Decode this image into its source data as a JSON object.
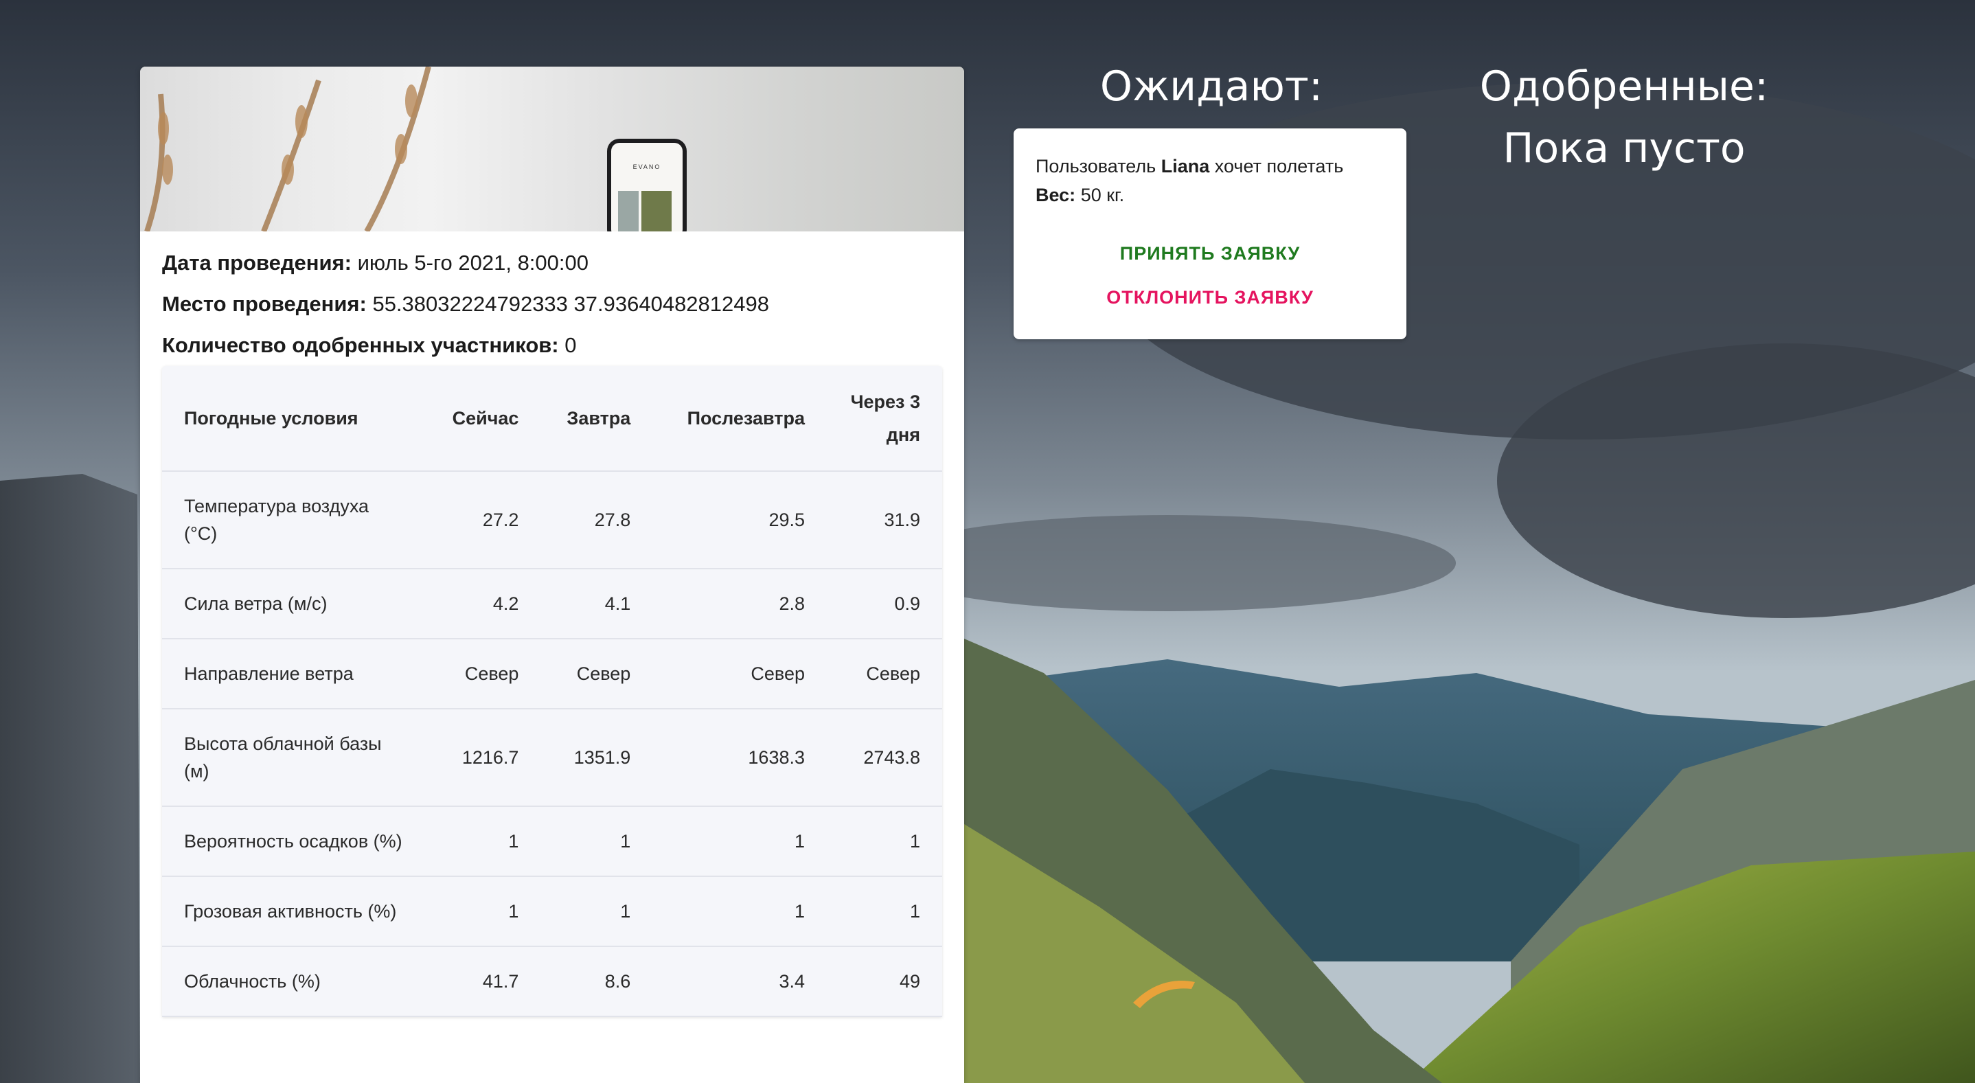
{
  "event": {
    "date_label": "Дата проведения:",
    "date_value": "июль 5-го 2021, 8:00:00",
    "place_label": "Место проведения:",
    "place_value": "55.38032224792333 37.93640482812498",
    "approved_count_label": "Количество одобренных участников:",
    "approved_count_value": "0",
    "image_icon": "phone-mockup-photo",
    "phone_brand": "EVANO"
  },
  "weather": {
    "headers": [
      "Погодные условия",
      "Сейчас",
      "Завтра",
      "Послезавтра",
      "Через 3 дня"
    ],
    "rows": [
      {
        "label": "Температура воздуха (°C)",
        "values": [
          "27.2",
          "27.8",
          "29.5",
          "31.9"
        ]
      },
      {
        "label": "Сила ветра (м/с)",
        "values": [
          "4.2",
          "4.1",
          "2.8",
          "0.9"
        ]
      },
      {
        "label": "Направление ветра",
        "values": [
          "Север",
          "Север",
          "Север",
          "Север"
        ]
      },
      {
        "label": "Высота облачной базы (м)",
        "values": [
          "1216.7",
          "1351.9",
          "1638.3",
          "2743.8"
        ]
      },
      {
        "label": "Вероятность осадков (%)",
        "values": [
          "1",
          "1",
          "1",
          "1"
        ]
      },
      {
        "label": "Грозовая активность (%)",
        "values": [
          "1",
          "1",
          "1",
          "1"
        ]
      },
      {
        "label": "Облачность (%)",
        "values": [
          "41.7",
          "8.6",
          "3.4",
          "49"
        ]
      }
    ]
  },
  "pending": {
    "heading": "Ожидают:",
    "request": {
      "prefix": "Пользователь",
      "user": "Liana",
      "suffix": "хочет полетать",
      "weight_label": "Вес:",
      "weight_value": "50 кг.",
      "accept_label": "ПРИНЯТЬ ЗАЯВКУ",
      "decline_label": "ОТКЛОНИТЬ ЗАЯВКУ"
    }
  },
  "approved": {
    "heading": "Одобренные:",
    "empty_text": "Пока пусто"
  },
  "colors": {
    "accept": "#1f7a1f",
    "decline": "#e5145f",
    "card": "#ffffff",
    "table_bg": "#f5f6fa"
  }
}
